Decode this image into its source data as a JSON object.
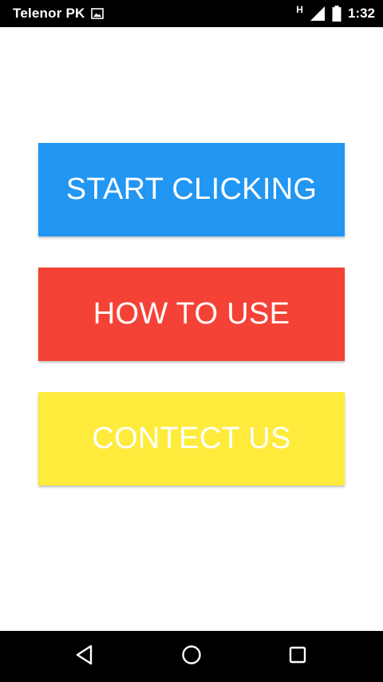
{
  "status_bar": {
    "carrier": "Telenor PK",
    "network_type": "H",
    "time": "1:32",
    "icons": [
      "image-notification-icon",
      "signal-icon",
      "battery-icon"
    ]
  },
  "buttons": {
    "start": {
      "label": "START CLICKING",
      "color": "#2196F3"
    },
    "how_to_use": {
      "label": "HOW TO USE",
      "color": "#F44336"
    },
    "contact": {
      "label": "CONTECT US",
      "color": "#FFEB3B"
    }
  },
  "nav_bar": {
    "icons": [
      "back-icon",
      "home-icon",
      "recents-icon"
    ]
  }
}
